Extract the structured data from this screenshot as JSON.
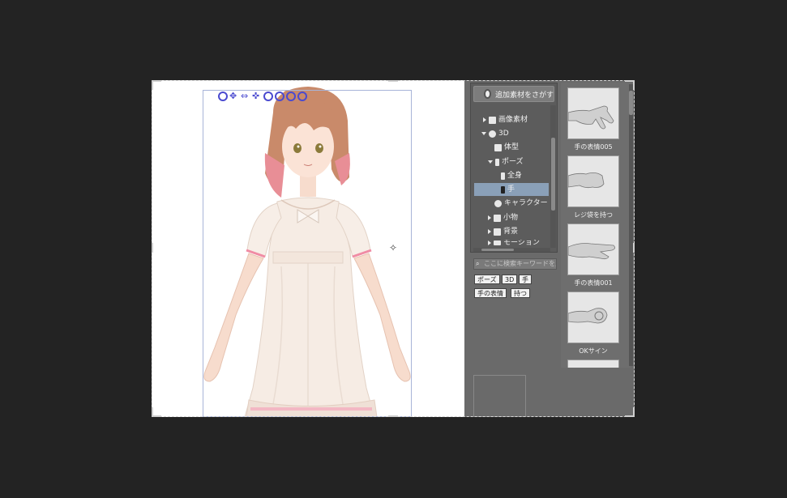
{
  "canvas": {
    "character_alt": "3D character model"
  },
  "material_palette": {
    "search_button_label": "追加素材をさがす",
    "tree": [
      {
        "label": "画像素材",
        "expanded": false
      },
      {
        "label": "3D",
        "expanded": true
      },
      {
        "label": "体型"
      },
      {
        "label": "ポーズ",
        "expanded": true
      },
      {
        "label": "全身"
      },
      {
        "label": "手",
        "selected": true
      },
      {
        "label": "キャラクター"
      },
      {
        "label": "小物",
        "expanded": false
      },
      {
        "label": "背景",
        "expanded": false
      },
      {
        "label": "モーション",
        "expanded": false
      }
    ],
    "keyword_placeholder": "ここに検索キーワードを入力して",
    "tags": [
      "ポーズ",
      "3D",
      "手",
      "手の表情",
      "持つ"
    ],
    "materials": [
      {
        "caption": "手の表情005"
      },
      {
        "caption": "レジ袋を持つ"
      },
      {
        "caption": "手の表情001"
      },
      {
        "caption": "OKサイン"
      }
    ]
  },
  "colors": {
    "background": "#232323",
    "canvas": "#ffffff",
    "palette": "#6a6a6a",
    "selection": "#8aa0b8",
    "gizmo": "#4a4ad0"
  }
}
